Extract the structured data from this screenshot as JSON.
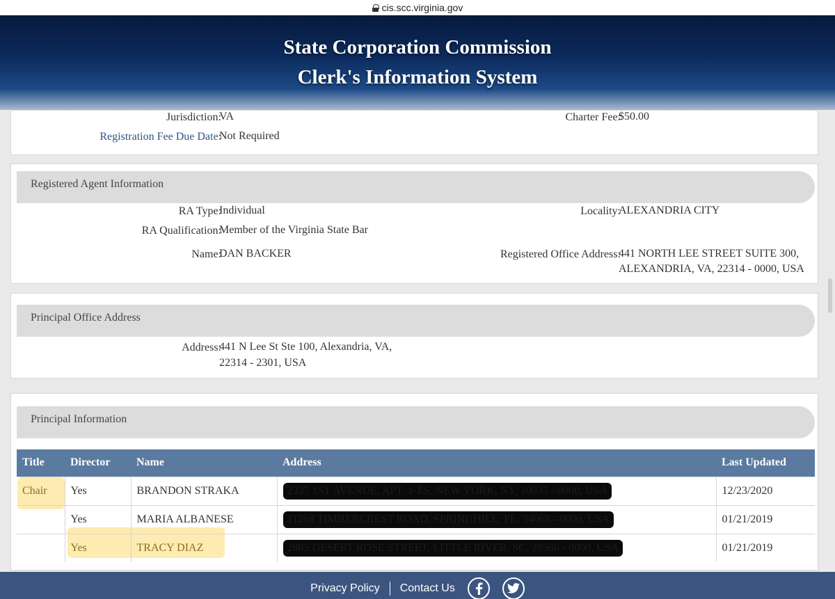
{
  "browser": {
    "url": "cis.scc.virginia.gov"
  },
  "header": {
    "title_line1": "State Corporation Commission",
    "title_line2": "Clerk's Information System"
  },
  "top": {
    "jurisdiction_label": "Jurisdiction:",
    "jurisdiction": "VA",
    "fee_due_label": "Registration Fee Due Date:",
    "fee_due": "Not Required",
    "charter_fee_label": "Charter Fee:",
    "charter_fee": "$50.00"
  },
  "agent": {
    "heading": "Registered Agent Information",
    "ra_type_label": "RA Type:",
    "ra_type": "Individual",
    "ra_qual_label": "RA Qualification:",
    "ra_qual": "Member of the Virginia State Bar",
    "name_label": "Name:",
    "name": "DAN BACKER",
    "locality_label": "Locality:",
    "locality": "ALEXANDRIA CITY",
    "office_label": "Registered Office Address:",
    "office_line1": "441 NORTH LEE STREET SUITE 300,",
    "office_line2": "ALEXANDRIA, VA, 22314 - 0000, USA"
  },
  "principal_office": {
    "heading": "Principal Office Address",
    "address_label": "Address:",
    "address_line1": "441 N Lee St Ste 100, Alexandria, VA,",
    "address_line2": "22314 - 2301, USA"
  },
  "principals": {
    "heading": "Principal Information",
    "columns": [
      "Title",
      "Director",
      "Name",
      "Address",
      "Last Updated"
    ],
    "rows": [
      {
        "title": "Chair",
        "director": "Yes",
        "name": "BRANDON STRAKA",
        "address": "2337 1ST AVENUE, APT. 1-ES, NEW YORK, NY, 10035 - 0000, USA",
        "updated": "12/23/2020"
      },
      {
        "title": "",
        "director": "Yes",
        "name": "MARIA ALBANESE",
        "address": "11268 TIMBERCREST ROAD, SPRINGHILL, FL, 34068 - 0000, USA",
        "updated": "01/21/2019"
      },
      {
        "title": "",
        "director": "Yes",
        "name": "TRACY DIAZ",
        "address": "2885 DESERT ROSE STREET, LITTLE RIVER, SC, 29566 - 0000, USA",
        "updated": "01/21/2019"
      }
    ]
  },
  "footer": {
    "privacy": "Privacy Policy",
    "contact": "Contact Us"
  },
  "colors": {
    "banner": "#0c2b5e",
    "table_header": "#5a7aa0",
    "footer": "#3b5580",
    "highlight": "#fde7a3"
  }
}
